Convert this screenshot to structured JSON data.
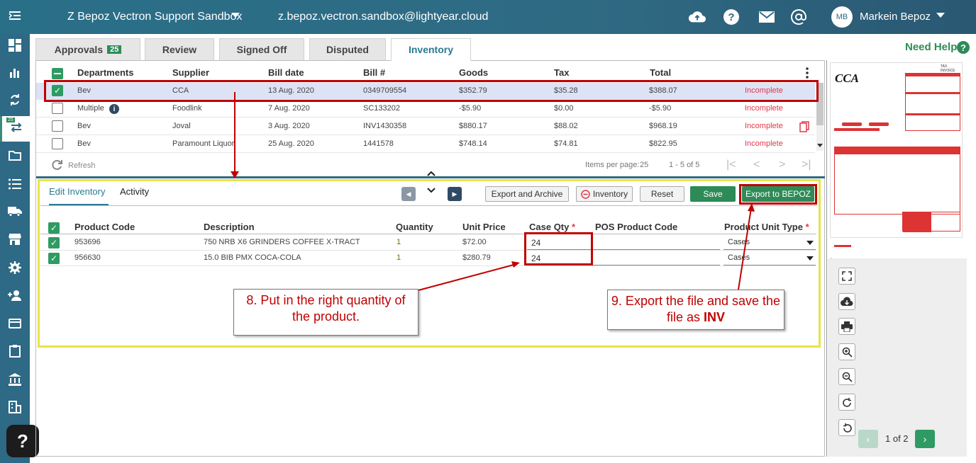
{
  "header": {
    "org_name": "Z Bepoz Vectron Support Sandbox",
    "email": "z.bepoz.vectron.sandbox@lightyear.cloud",
    "avatar_initials": "MB",
    "user_name": "Markein Bepoz"
  },
  "sidebar": {
    "badge": "25"
  },
  "tabs": [
    {
      "label": "Approvals",
      "badge": "25"
    },
    {
      "label": "Review"
    },
    {
      "label": "Signed Off"
    },
    {
      "label": "Disputed"
    },
    {
      "label": "Inventory"
    }
  ],
  "need_help": "Need Help",
  "bills": {
    "columns": [
      "Departments",
      "Supplier",
      "Bill date",
      "Bill #",
      "Goods",
      "Tax",
      "Total"
    ],
    "rows": [
      {
        "dept": "Bev",
        "supplier": "CCA",
        "date": "13 Aug. 2020",
        "bill": "0349709554",
        "goods": "$352.79",
        "tax": "$35.28",
        "total": "$388.07",
        "status": "Incomplete"
      },
      {
        "dept": "Multiple",
        "supplier": "Foodlink",
        "date": "7 Aug. 2020",
        "bill": "SC133202",
        "goods": "-$5.90",
        "tax": "$0.00",
        "total": "-$5.90",
        "status": "Incomplete"
      },
      {
        "dept": "Bev",
        "supplier": "Joval",
        "date": "3 Aug. 2020",
        "bill": "INV1430358",
        "goods": "$880.17",
        "tax": "$88.02",
        "total": "$968.19",
        "status": "Incomplete"
      },
      {
        "dept": "Bev",
        "supplier": "Paramount Liquor",
        "date": "25 Aug. 2020",
        "bill": "1441578",
        "goods": "$748.14",
        "tax": "$74.81",
        "total": "$822.95",
        "status": "Incomplete"
      }
    ],
    "refresh": "Refresh",
    "items_per_page_label": "Items per page:",
    "items_per_page": "25",
    "range": "1 - 5 of 5"
  },
  "inventory": {
    "tab_edit": "Edit Inventory",
    "tab_activity": "Activity",
    "btn_export_archive": "Export and Archive",
    "btn_inventory": "Inventory",
    "btn_reset": "Reset",
    "btn_save": "Save",
    "btn_export_bepoz": "Export to BEPOZ",
    "columns": [
      "Product Code",
      "Description",
      "Quantity",
      "Unit Price",
      "Case Qty",
      "POS Product Code",
      "Product Unit Type"
    ],
    "rows": [
      {
        "code": "953696",
        "desc": "750 NRB X6 GRINDERS COFFEE X-TRACT",
        "qty": "1",
        "price": "$72.00",
        "case_qty": "24",
        "pos_code": "",
        "unit_type": "Cases"
      },
      {
        "code": "956630",
        "desc": "15.0 BIB PMX COCA-COLA",
        "qty": "1",
        "price": "$280.79",
        "case_qty": "24",
        "pos_code": "",
        "unit_type": "Cases"
      }
    ]
  },
  "callouts": {
    "step8": "8. Put in the right quantity of the product.",
    "step9_prefix": "9. Export the file and save the file as",
    "step9_bold": "INV"
  },
  "viewer": {
    "page_indicator": "1 of 2",
    "logo_text": "CCA",
    "invoice_title": "TAX INVOICE"
  }
}
